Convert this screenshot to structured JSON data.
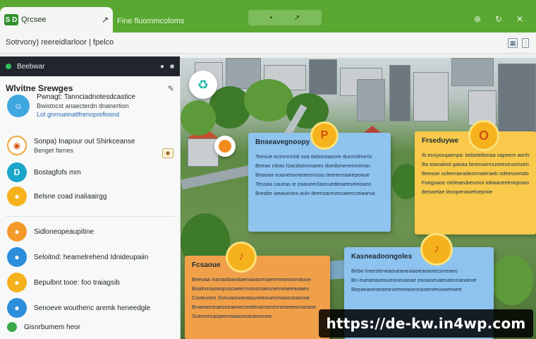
{
  "browser": {
    "tab_title": "Qrcsee",
    "tab_logo": "S D",
    "tab_new_label": "↗",
    "tab2_title": "Fine fluommcoloms",
    "search_glyph_1": "▪",
    "search_glyph_2": "↗",
    "address_text": "Sotrvony) reereidlarloor | fpelco",
    "icons": [
      "tab-list-icon",
      "minimize-icon",
      "maximize-icon",
      "close-icon"
    ]
  },
  "panel": {
    "top_title": "Beebwar",
    "header_title": "Wlvitne Srewges",
    "items": [
      {
        "l1": "Pwnagt: Tannciadnotesdcastice",
        "l2": "Bwistocst anaecterdn dnanertion",
        "l3": "Lot gnrnueinatlfrenoprefiosnd"
      },
      {
        "l1": "Sonpa) Inapour out Shirkceanse",
        "l2": "Benget farnes",
        "badge": "◉"
      },
      {
        "l1": "Bostagfofs mm"
      },
      {
        "l1": "Belsne coad inaliaairgg"
      },
      {
        "l1": "Sidloneopeaupitine"
      },
      {
        "l1": "Seloitnd: heamelrehend Idnideupaiin"
      },
      {
        "l1": "Bepulbnt tooe: foo traiagsib"
      },
      {
        "l1": "Senoeve wouthenc aremk heneedgle"
      },
      {
        "l1": "Gisnrbumem heor"
      }
    ]
  },
  "notes": {
    "blue1": {
      "title": "Bnseavegnoopy",
      "lines": [
        "Teesue ecinmnntal soa dalsoniaoore dunnrdmeris",
        "Beeae cteas loacdoeomaees doedonenemnimon",
        "Beaeaa euaneoomeaeomusu teenenraarepoaue",
        "Tessaa caueas ie eaaoeeclaonuedieaeeseieoaeo",
        "Breabe iaeauesea aulo deensareumcaeecceiaarua"
      ]
    },
    "yellow": {
      "title": "Frseduywe",
      "lines": [
        "Ib enoyosqaenpa: bebetelionaa sapeem aenhnae",
        "Ba toanaiiod gaoaa biveniamnuneeseusmseise",
        "Beesoe soleenaeadeonnaieraeb odeesoendoeroe",
        "Foegsaoe cteleaeubeumoi tobaaneetmepnasanale",
        "Beswelae leoopenaoefoepniie"
      ]
    },
    "orange": {
      "title": "Fcsaoue",
      "lines": [
        "Beeoaa inanaobaealaenaoaorniaeemeanoomauoe",
        "Boalnosaoanpusoaeecnsinsmaeunerneaeeawaeu",
        "Cooeuoen Sonuaonoeoasuseeoueomasoceaonoe",
        "Bnaeaoneaeoseaeoecondeuamecesneseeeonueaoe",
        "Sueonesaopeenoaaoeuaueoonea"
      ]
    },
    "blue2": {
      "title": "Kasneadoongoles",
      "lines": [
        "Bebe Ineesleneaoueaoeaiaoeaeaoecsmeaeo",
        "Bn eueaeiaoeaueoneuaoae eaoaoeuaeoaeonaoaeoe",
        "Bepaeaoeoeaeanomeeaseonaoeneeuoaeeaee"
      ]
    }
  },
  "watermark": "https://de-kw.in4wp.com",
  "colors": {
    "brand_green": "#5aa832",
    "note_blue": "#8fc4ef",
    "note_yellow": "#f8c94a",
    "note_orange": "#f1a04a",
    "pin_orange": "#f6b21c"
  }
}
